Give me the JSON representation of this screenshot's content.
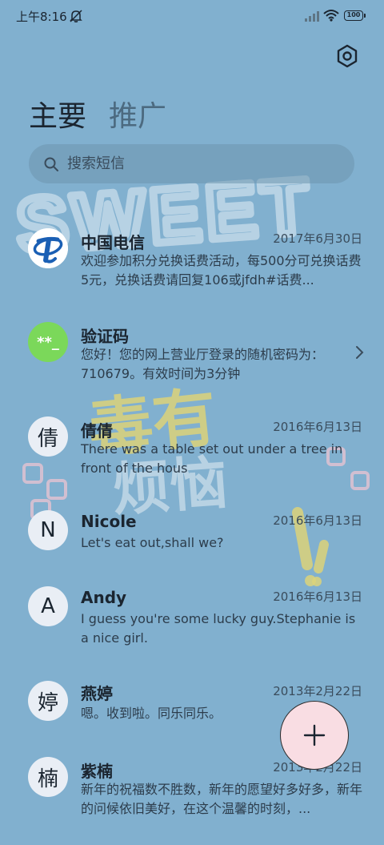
{
  "status_bar": {
    "time": "上午8:16",
    "battery": "100"
  },
  "icons": {
    "settings": "gear-hexagon-icon",
    "search": "search-icon",
    "compose": "plus-icon",
    "chevron": "chevron-right-icon",
    "dnd": "bell-off-icon",
    "signal": "signal-icon",
    "wifi": "wifi-icon"
  },
  "tabs": [
    {
      "label": "主要",
      "selected": true
    },
    {
      "label": "推广",
      "selected": false
    }
  ],
  "search": {
    "placeholder": "搜索短信"
  },
  "conversations": [
    {
      "avatar_text": "",
      "avatar_type": "telecom-logo",
      "name": "中国电信",
      "date": "2017年6月30日",
      "preview": "欢迎参加积分兑换话费活动，每500分可兑换话费5元，兑换话费请回复106或jfdh#话费..."
    },
    {
      "avatar_text": "**_",
      "avatar_type": "code",
      "name": "验证码",
      "date": "",
      "preview": "您好！您的网上营业厅登录的随机密码为：710679。有效时间为3分钟"
    },
    {
      "avatar_text": "倩",
      "avatar_type": "letter",
      "name": "倩倩",
      "date": "2016年6月13日",
      "preview": "There was a table set out under a tree in front of the hous"
    },
    {
      "avatar_text": "N",
      "avatar_type": "letter",
      "name": "Nicole",
      "date": "2016年6月13日",
      "preview": "Let's eat out,shall we?"
    },
    {
      "avatar_text": "A",
      "avatar_type": "letter",
      "name": "Andy",
      "date": "2016年6月13日",
      "preview": "I guess you're some lucky guy.Stephanie is a nice girl."
    },
    {
      "avatar_text": "婷",
      "avatar_type": "letter",
      "name": "燕婷",
      "date": "2013年2月22日",
      "preview": "嗯。收到啦。同乐同乐。"
    },
    {
      "avatar_text": "楠",
      "avatar_type": "letter",
      "name": "紫楠",
      "date": "2013年2月22日",
      "preview": "新年的祝福数不胜数，新年的愿望好多好多，新年的问候依旧美好，在这个温馨的时刻，..."
    }
  ],
  "wallpaper": {
    "text_top": "SWEET",
    "text_mid": "毒有烦恼",
    "colors": {
      "background": "#81b0cf",
      "yellow": "#dcd37a",
      "pink": "#f0bcc9",
      "white": "#ffffff"
    }
  },
  "colors": {
    "telecom_blue": "#1a5fb4",
    "code_green": "#7bd85a",
    "fab_bg": "#f9dde3"
  }
}
